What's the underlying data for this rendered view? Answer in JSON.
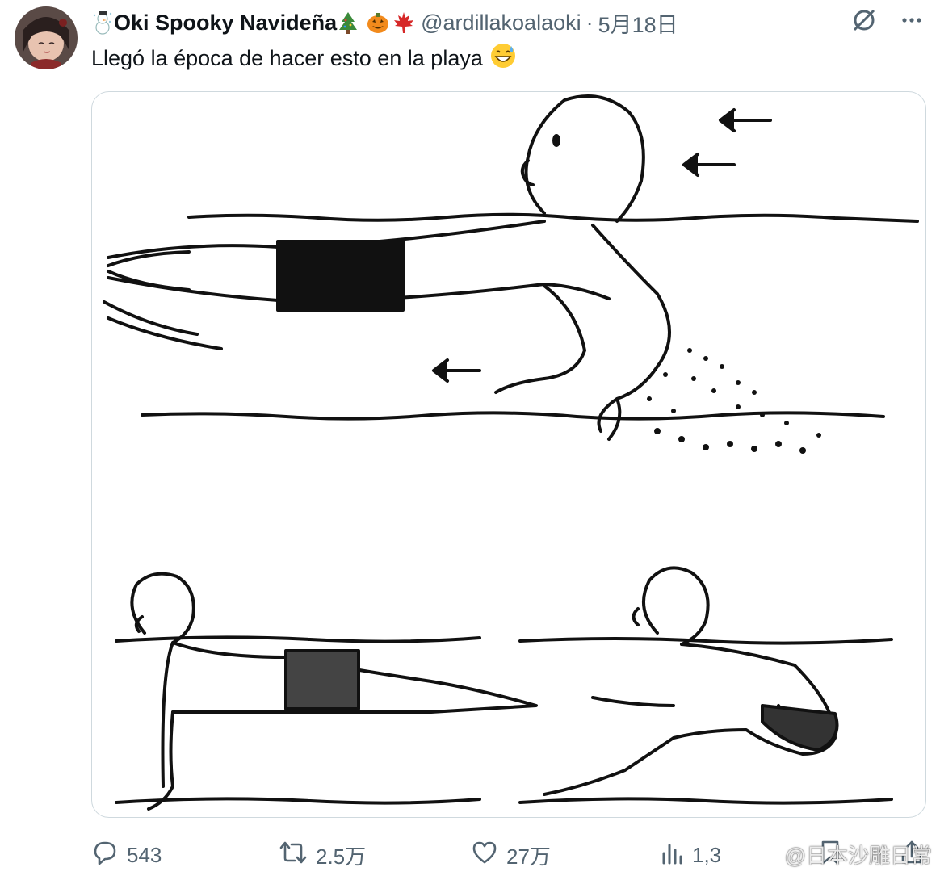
{
  "tweet": {
    "display_name": "Oki Spooky Navideña",
    "handle": "@ardillakoalaoki",
    "separator": "·",
    "date": "5月18日",
    "text": "Llegó la época de hacer esto en la playa",
    "text_emoji": "grinning-sweat-emoji",
    "name_emojis": [
      "snowman-emoji",
      "christmas-tree-emoji",
      "jack-o-lantern-emoji",
      "maple-leaf-emoji"
    ]
  },
  "header_icons": [
    "grok-icon",
    "more-icon"
  ],
  "media": {
    "description_icon": "line-drawing-illustration"
  },
  "actions": {
    "replies": "543",
    "reposts": "2.5万",
    "likes": "27万",
    "views": "1,3"
  },
  "watermark": "@日本沙雕日常",
  "colors": {
    "text": "#0f1419",
    "secondary": "#536471",
    "border": "#cfd9de"
  }
}
